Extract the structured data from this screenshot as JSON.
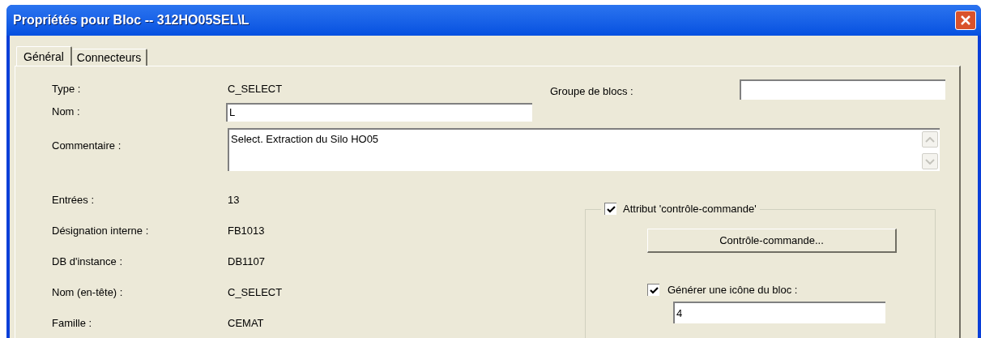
{
  "window": {
    "title": "Propriétés pour Bloc -- 312HO05SEL\\L"
  },
  "tabs": [
    {
      "label": "Général",
      "selected": true
    },
    {
      "label": "Connecteurs",
      "selected": false
    }
  ],
  "type": {
    "label": "Type :",
    "value": "C_SELECT"
  },
  "nom": {
    "label": "Nom :",
    "value": "L"
  },
  "groupe": {
    "label": "Groupe de blocs :"
  },
  "commentaire": {
    "label": "Commentaire :",
    "value": "Select. Extraction du Silo HO05"
  },
  "info_rows": [
    {
      "label": "Entrées :",
      "value": "13"
    },
    {
      "label": "Désignation interne :",
      "value": "FB1013"
    },
    {
      "label": "DB d'instance :",
      "value": "DB1107"
    },
    {
      "label": "Nom (en-tête) :",
      "value": "C_SELECT"
    },
    {
      "label": "Famille :",
      "value": "CEMAT"
    }
  ],
  "cc_group": {
    "label": "Attribut 'contrôle-commande'",
    "checked": true,
    "button": "Contrôle-commande...",
    "icon_checkbox": {
      "label": "Générer une icône du bloc :",
      "checked": true
    },
    "icon_value": "4"
  }
}
